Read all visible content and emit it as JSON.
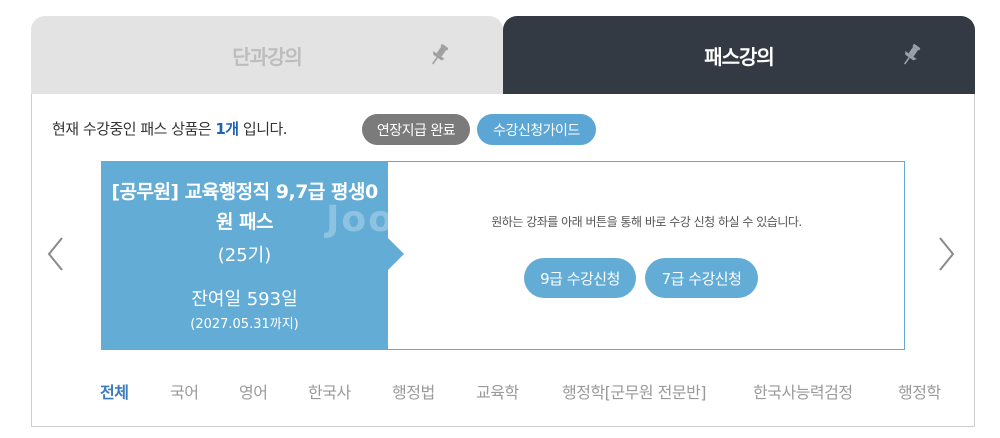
{
  "tabs": [
    {
      "label": "단과강의",
      "active": false
    },
    {
      "label": "패스강의",
      "active": true
    }
  ],
  "info": {
    "prefix": "현재 수강중인 패스 상품은 ",
    "count": "1개",
    "suffix": " 입니다."
  },
  "buttons": {
    "extension": "연장지급 완료",
    "guide": "수강신청가이드"
  },
  "course": {
    "title": "[공무원] 교육행정직 9,7급 평생0원 패스",
    "term": "(25기)",
    "remaining": "잔여일 593일",
    "until": "(2027.05.31까지)",
    "watermark": "Joo"
  },
  "enroll": {
    "instruction": "원하는 강좌를 아래 버튼을 통해 바로 수강 신청 하실 수 있습니다.",
    "grade9": "9급 수강신청",
    "grade7": "7급 수강신청"
  },
  "categories": [
    "전체",
    "국어",
    "영어",
    "한국사",
    "행정법",
    "교육학",
    "행정학[군무원 전문반]",
    "한국사능력검정",
    "행정학"
  ],
  "colors": {
    "accent": "#62acd6",
    "dark_tab": "#343a44",
    "active_category": "#3a7dbf"
  },
  "icons": {
    "pin": "pin-icon",
    "prev": "chevron-left-icon",
    "next": "chevron-right-icon"
  }
}
